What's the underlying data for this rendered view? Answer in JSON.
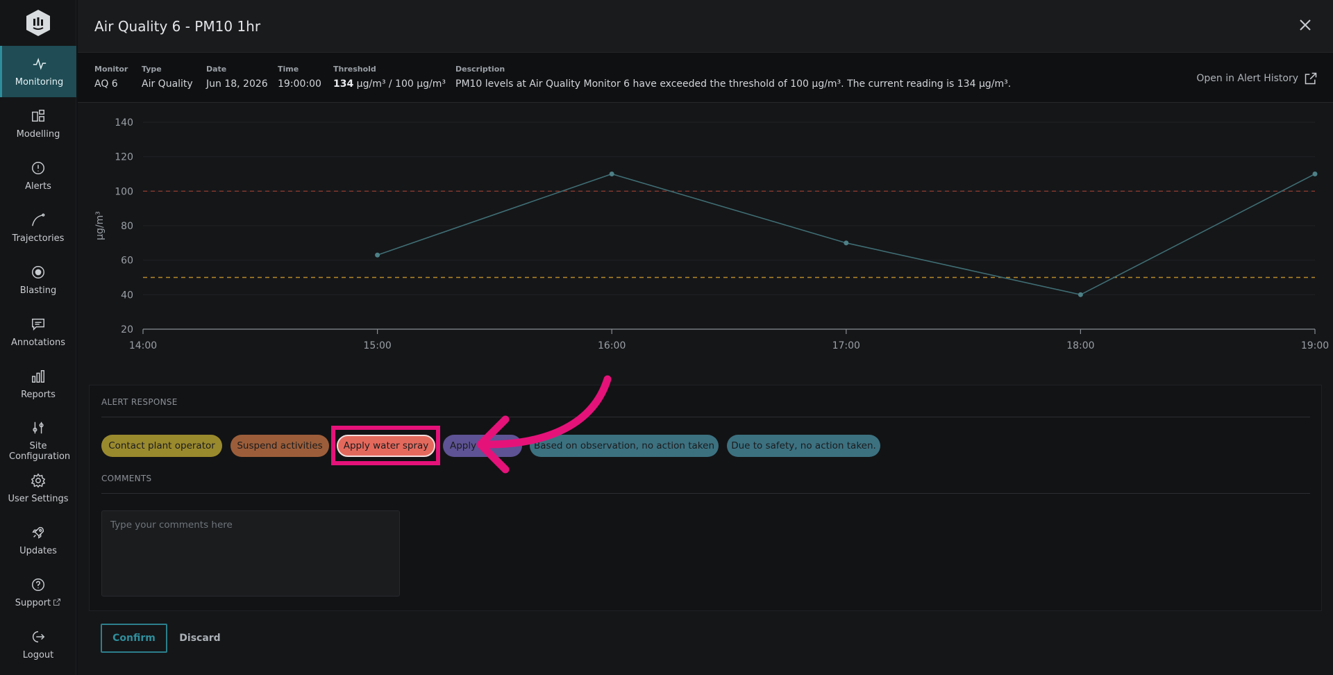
{
  "sidebar": {
    "items": [
      {
        "label": "Monitoring",
        "icon": "pulse-icon"
      },
      {
        "label": "Modelling",
        "icon": "modelling-icon"
      },
      {
        "label": "Alerts",
        "icon": "alert-circle-icon"
      },
      {
        "label": "Trajectories",
        "icon": "trajectory-icon"
      },
      {
        "label": "Blasting",
        "icon": "target-icon"
      },
      {
        "label": "Annotations",
        "icon": "comment-icon"
      },
      {
        "label": "Reports",
        "icon": "bar-chart-icon"
      },
      {
        "label": "Site Configuration",
        "icon": "sliders-icon"
      },
      {
        "label": "User Settings",
        "icon": "gear-icon"
      },
      {
        "label": "Updates",
        "icon": "rocket-icon"
      },
      {
        "label": "Support",
        "icon": "help-icon"
      },
      {
        "label": "Logout",
        "icon": "logout-icon"
      }
    ],
    "active": "Monitoring"
  },
  "modal": {
    "title": "Air Quality 6 - PM10 1hr",
    "info": {
      "monitor_label": "Monitor",
      "monitor": "AQ 6",
      "type_label": "Type",
      "type": "Air Quality",
      "date_label": "Date",
      "date": "Jun 18, 2026",
      "time_label": "Time",
      "time": "19:00:00",
      "threshold_label": "Threshold",
      "threshold_value": "134",
      "threshold_rest": " µg/m³ / 100 µg/m³",
      "description_label": "Description",
      "description": "PM10 levels at Air Quality Monitor 6 have exceeded the threshold of 100 µg/m³. The current reading is 134 µg/m³."
    },
    "open_history_label": "Open in Alert History"
  },
  "chart_data": {
    "type": "line",
    "x": [
      "15:00",
      "16:00",
      "17:00",
      "18:00",
      "19:00"
    ],
    "y": [
      63,
      110,
      70,
      40,
      110
    ],
    "x_ticks": [
      "14:00",
      "15:00",
      "16:00",
      "17:00",
      "18:00",
      "19:00"
    ],
    "y_ticks": [
      20,
      40,
      60,
      80,
      100,
      120,
      140
    ],
    "ylim": [
      20,
      140
    ],
    "ylabel": "µg/m³",
    "thresholds": [
      {
        "value": 100,
        "color": "#8a3a2e"
      },
      {
        "value": 50,
        "color": "#b8892a"
      }
    ],
    "line_color": "#3f6e74",
    "grid": true
  },
  "response": {
    "section_label": "ALERT RESPONSE",
    "chips": [
      {
        "label": "Contact plant operator",
        "color": "yellow"
      },
      {
        "label": "Suspend activities",
        "color": "orange"
      },
      {
        "label": "Apply water spray",
        "color": "red"
      },
      {
        "label": "Apply",
        "color": "purple"
      },
      {
        "label": "Based on observation, no action taken",
        "color": "teal"
      },
      {
        "label": "Due to safety, no action taken.",
        "color": "teal"
      }
    ],
    "comments_label": "COMMENTS",
    "comments_placeholder": "Type your comments here"
  },
  "actions": {
    "confirm": "Confirm",
    "discard": "Discard"
  },
  "colors": {
    "accent": "#2f8e9c",
    "highlight": "#e5127a"
  }
}
